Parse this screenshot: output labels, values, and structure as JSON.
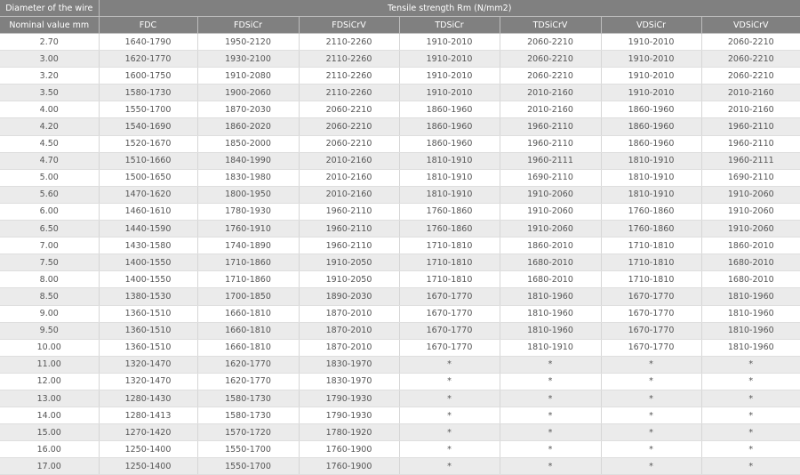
{
  "header": {
    "diameter_title": "Diameter of the wire",
    "tensile_title": "Tensile strength Rm (N/mm2)",
    "columns": [
      "Nominal value mm",
      "FDC",
      "FDSiCr",
      "FDSiCrV",
      "TDSiCr",
      "TDSiCrV",
      "VDSiCr",
      "VDSiCrV"
    ]
  },
  "rows": [
    [
      "2.70",
      "1640-1790",
      "1950-2120",
      "2110-2260",
      "1910-2010",
      "2060-2210",
      "1910-2010",
      "2060-2210"
    ],
    [
      "3.00",
      "1620-1770",
      "1930-2100",
      "2110-2260",
      "1910-2010",
      "2060-2210",
      "1910-2010",
      "2060-2210"
    ],
    [
      "3.20",
      "1600-1750",
      "1910-2080",
      "2110-2260",
      "1910-2010",
      "2060-2210",
      "1910-2010",
      "2060-2210"
    ],
    [
      "3.50",
      "1580-1730",
      "1900-2060",
      "2110-2260",
      "1910-2010",
      "2010-2160",
      "1910-2010",
      "2010-2160"
    ],
    [
      "4.00",
      "1550-1700",
      "1870-2030",
      "2060-2210",
      "1860-1960",
      "2010-2160",
      "1860-1960",
      "2010-2160"
    ],
    [
      "4.20",
      "1540-1690",
      "1860-2020",
      "2060-2210",
      "1860-1960",
      "1960-2110",
      "1860-1960",
      "1960-2110"
    ],
    [
      "4.50",
      "1520-1670",
      "1850-2000",
      "2060-2210",
      "1860-1960",
      "1960-2110",
      "1860-1960",
      "1960-2110"
    ],
    [
      "4.70",
      "1510-1660",
      "1840-1990",
      "2010-2160",
      "1810-1910",
      "1960-2111",
      "1810-1910",
      "1960-2111"
    ],
    [
      "5.00",
      "1500-1650",
      "1830-1980",
      "2010-2160",
      "1810-1910",
      "1690-2110",
      "1810-1910",
      "1690-2110"
    ],
    [
      "5.60",
      "1470-1620",
      "1800-1950",
      "2010-2160",
      "1810-1910",
      "1910-2060",
      "1810-1910",
      "1910-2060"
    ],
    [
      "6.00",
      "1460-1610",
      "1780-1930",
      "1960-2110",
      "1760-1860",
      "1910-2060",
      "1760-1860",
      "1910-2060"
    ],
    [
      "6.50",
      "1440-1590",
      "1760-1910",
      "1960-2110",
      "1760-1860",
      "1910-2060",
      "1760-1860",
      "1910-2060"
    ],
    [
      "7.00",
      "1430-1580",
      "1740-1890",
      "1960-2110",
      "1710-1810",
      "1860-2010",
      "1710-1810",
      "1860-2010"
    ],
    [
      "7.50",
      "1400-1550",
      "1710-1860",
      "1910-2050",
      "1710-1810",
      "1680-2010",
      "1710-1810",
      "1680-2010"
    ],
    [
      "8.00",
      "1400-1550",
      "1710-1860",
      "1910-2050",
      "1710-1810",
      "1680-2010",
      "1710-1810",
      "1680-2010"
    ],
    [
      "8.50",
      "1380-1530",
      "1700-1850",
      "1890-2030",
      "1670-1770",
      "1810-1960",
      "1670-1770",
      "1810-1960"
    ],
    [
      "9.00",
      "1360-1510",
      "1660-1810",
      "1870-2010",
      "1670-1770",
      "1810-1960",
      "1670-1770",
      "1810-1960"
    ],
    [
      "9.50",
      "1360-1510",
      "1660-1810",
      "1870-2010",
      "1670-1770",
      "1810-1960",
      "1670-1770",
      "1810-1960"
    ],
    [
      "10.00",
      "1360-1510",
      "1660-1810",
      "1870-2010",
      "1670-1770",
      "1810-1910",
      "1670-1770",
      "1810-1960"
    ],
    [
      "11.00",
      "1320-1470",
      "1620-1770",
      "1830-1970",
      "*",
      "*",
      "*",
      "*"
    ],
    [
      "12.00",
      "1320-1470",
      "1620-1770",
      "1830-1970",
      "*",
      "*",
      "*",
      "*"
    ],
    [
      "13.00",
      "1280-1430",
      "1580-1730",
      "1790-1930",
      "*",
      "*",
      "*",
      "*"
    ],
    [
      "14.00",
      "1280-1413",
      "1580-1730",
      "1790-1930",
      "*",
      "*",
      "*",
      "*"
    ],
    [
      "15.00",
      "1270-1420",
      "1570-1720",
      "1780-1920",
      "*",
      "*",
      "*",
      "*"
    ],
    [
      "16.00",
      "1250-1400",
      "1550-1700",
      "1760-1900",
      "*",
      "*",
      "*",
      "*"
    ],
    [
      "17.00",
      "1250-1400",
      "1550-1700",
      "1760-1900",
      "*",
      "*",
      "*",
      "*"
    ]
  ]
}
